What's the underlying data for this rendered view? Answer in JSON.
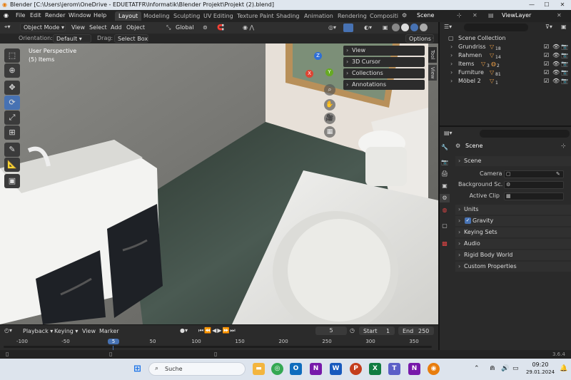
{
  "window": {
    "title": "Blender [C:\\Users\\jerom\\OneDrive - EDUETATFR\\Informatik\\Blender Projekt\\Projekt (2).blend]"
  },
  "menubar": {
    "menus": [
      "File",
      "Edit",
      "Render",
      "Window",
      "Help"
    ],
    "workspaces": [
      "Layout",
      "Modeling",
      "Sculpting",
      "UV Editing",
      "Texture Paint",
      "Shading",
      "Animation",
      "Rendering",
      "Compositin"
    ],
    "active_workspace": "Layout",
    "scene": "Scene",
    "view_layer": "ViewLayer"
  },
  "viewport_header": {
    "mode": "Object Mode",
    "menus": [
      "View",
      "Select",
      "Add",
      "Object"
    ],
    "transform_orientation": "Global",
    "orientation_label": "Orientation:",
    "orientation_value": "Default",
    "drag_label": "Drag:",
    "drag_value": "Select Box",
    "options": "Options"
  },
  "viewport": {
    "overlay_line1": "User Perspective",
    "overlay_line2": "(5) Items",
    "npanel_sections": [
      "View",
      "3D Cursor",
      "Collections",
      "Annotations"
    ],
    "side_tabs": [
      "Tool",
      "View"
    ],
    "gizmo_axes": {
      "x": "X",
      "y": "Y",
      "z": "Z"
    }
  },
  "outliner": {
    "root": "Scene Collection",
    "items": [
      {
        "name": "Grundriss",
        "badge": "18"
      },
      {
        "name": "Rahmen",
        "badge": "14"
      },
      {
        "name": "Items",
        "badge": "3",
        "badge2": "2"
      },
      {
        "name": "Furniture",
        "badge": "81"
      },
      {
        "name": "Möbel 2",
        "badge": "1"
      }
    ]
  },
  "properties": {
    "title": "Scene",
    "scene_section": "Scene",
    "camera_label": "Camera",
    "background_label": "Background Sc...",
    "active_clip_label": "Active Clip",
    "sections": [
      "Units",
      "Gravity",
      "Keying Sets",
      "Audio",
      "Rigid Body World",
      "Custom Properties"
    ],
    "gravity_checked": true
  },
  "timeline": {
    "menus": [
      "Playback",
      "Keying",
      "View",
      "Marker"
    ],
    "current_frame": "5",
    "start_label": "Start",
    "start": "1",
    "end_label": "End",
    "end": "250",
    "ticks": [
      "-100",
      "-50",
      "5",
      "50",
      "100",
      "150",
      "200",
      "250",
      "300",
      "350"
    ]
  },
  "statusbar": {
    "version": "3.6.4"
  },
  "taskbar": {
    "search": "Suche",
    "time": "09:20",
    "date": "29.01.2024"
  }
}
